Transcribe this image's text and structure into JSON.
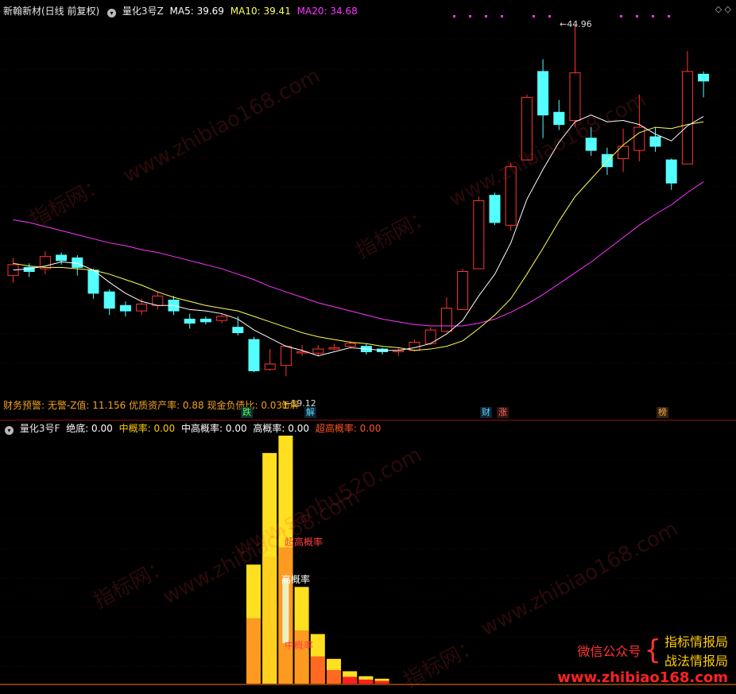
{
  "top": {
    "stock_label": "新翰新材(日线 前复权)",
    "indicator": "量化3号Z",
    "ma5": "MA5: 39.69",
    "ma10": "MA10: 39.41",
    "ma20": "MA20: 34.68",
    "high_label": "44.96",
    "low_label": "19.12",
    "warn_text": "财务预警: 无警-Z值: 11.156 优质资产率: 0.88 现金负债比: 0.031",
    "markers": [
      "跌",
      "解",
      "财",
      "涨",
      "榜"
    ],
    "overlay_text": "缶解"
  },
  "bottom": {
    "indicator": "量化3号F",
    "jue_di": "绝底: 0.00",
    "zhong_gai": "中概率: 0.00",
    "zhong_gao_gai": "中高概率: 0.00",
    "gao_gai": "高概率: 0.00",
    "chao_gao_gai": "超高概率: 0.00",
    "label_chao": "超高概率",
    "label_gao": "高概率",
    "label_zhong": "中概率"
  },
  "brand": {
    "wechat": "微信公众号",
    "line1": "指标情报局",
    "line2": "战法情报局",
    "url": "www.zhibiao168.com"
  },
  "watermarks": [
    "www.zhibiao168.com",
    "指标网：",
    "www.sanhu520.com"
  ],
  "colors": {
    "up": "#ff3333",
    "down": "#54ffff",
    "ma5": "#ffffff",
    "ma10": "#ffff55",
    "ma20": "#ff33ff"
  },
  "chart_data": {
    "type": "candlestick",
    "ma_values": {
      "MA5": 39.69,
      "MA10": 39.41,
      "MA20": 34.68
    },
    "high": 44.96,
    "low": 19.12,
    "candles": [
      {
        "o": 26.5,
        "c": 27.3,
        "h": 27.8,
        "l": 26.0
      },
      {
        "o": 27.1,
        "c": 26.8,
        "h": 27.4,
        "l": 26.4
      },
      {
        "o": 27.0,
        "c": 27.9,
        "h": 28.3,
        "l": 26.6
      },
      {
        "o": 28.0,
        "c": 27.6,
        "h": 28.2,
        "l": 27.3
      },
      {
        "o": 27.8,
        "c": 27.1,
        "h": 28.0,
        "l": 26.5
      },
      {
        "o": 26.9,
        "c": 25.2,
        "h": 27.0,
        "l": 24.8
      },
      {
        "o": 25.3,
        "c": 24.1,
        "h": 25.5,
        "l": 23.6
      },
      {
        "o": 24.3,
        "c": 23.9,
        "h": 24.6,
        "l": 23.5
      },
      {
        "o": 23.9,
        "c": 24.4,
        "h": 24.8,
        "l": 23.6
      },
      {
        "o": 24.3,
        "c": 25.0,
        "h": 25.3,
        "l": 24.0
      },
      {
        "o": 24.7,
        "c": 23.9,
        "h": 25.0,
        "l": 23.6
      },
      {
        "o": 23.3,
        "c": 23.0,
        "h": 23.7,
        "l": 22.6
      },
      {
        "o": 23.3,
        "c": 23.1,
        "h": 23.5,
        "l": 22.9
      },
      {
        "o": 23.2,
        "c": 23.5,
        "h": 23.7,
        "l": 23.0
      },
      {
        "o": 22.7,
        "c": 22.3,
        "h": 23.5,
        "l": 22.1
      },
      {
        "o": 21.8,
        "c": 19.5,
        "h": 22.0,
        "l": 19.4
      },
      {
        "o": 19.6,
        "c": 20.0,
        "h": 21.1,
        "l": 19.5
      },
      {
        "o": 19.9,
        "c": 21.3,
        "h": 21.4,
        "l": 19.1
      },
      {
        "o": 20.9,
        "c": 20.9,
        "h": 21.4,
        "l": 20.6
      },
      {
        "o": 20.8,
        "c": 21.1,
        "h": 21.4,
        "l": 20.6
      },
      {
        "o": 21.1,
        "c": 21.2,
        "h": 21.5,
        "l": 21.0
      },
      {
        "o": 21.3,
        "c": 21.5,
        "h": 21.7,
        "l": 21.2
      },
      {
        "o": 21.3,
        "c": 20.9,
        "h": 21.5,
        "l": 20.7
      },
      {
        "o": 21.1,
        "c": 20.9,
        "h": 21.2,
        "l": 20.7
      },
      {
        "o": 20.9,
        "c": 21.0,
        "h": 21.2,
        "l": 20.6
      },
      {
        "o": 21.0,
        "c": 21.6,
        "h": 21.8,
        "l": 20.9
      },
      {
        "o": 21.5,
        "c": 22.5,
        "h": 22.7,
        "l": 21.4
      },
      {
        "o": 22.4,
        "c": 24.1,
        "h": 24.9,
        "l": 22.3
      },
      {
        "o": 24.0,
        "c": 26.8,
        "h": 27.0,
        "l": 24.0
      },
      {
        "o": 27.0,
        "c": 32.0,
        "h": 32.3,
        "l": 27.0
      },
      {
        "o": 32.4,
        "c": 30.4,
        "h": 32.6,
        "l": 30.2
      },
      {
        "o": 30.2,
        "c": 34.5,
        "h": 34.8,
        "l": 29.8
      },
      {
        "o": 35.0,
        "c": 39.6,
        "h": 39.8,
        "l": 35.0
      },
      {
        "o": 41.5,
        "c": 38.3,
        "h": 42.4,
        "l": 36.6
      },
      {
        "o": 38.5,
        "c": 37.6,
        "h": 39.4,
        "l": 37.2
      },
      {
        "o": 37.9,
        "c": 41.4,
        "h": 44.96,
        "l": 37.4
      },
      {
        "o": 36.6,
        "c": 35.7,
        "h": 37.4,
        "l": 35.3
      },
      {
        "o": 35.4,
        "c": 34.5,
        "h": 35.9,
        "l": 33.9
      },
      {
        "o": 35.1,
        "c": 36.0,
        "h": 37.3,
        "l": 34.1
      },
      {
        "o": 35.7,
        "c": 37.4,
        "h": 39.8,
        "l": 34.9
      },
      {
        "o": 36.7,
        "c": 36.0,
        "h": 37.4,
        "l": 35.6
      },
      {
        "o": 35.0,
        "c": 33.3,
        "h": 35.1,
        "l": 32.8
      },
      {
        "o": 34.7,
        "c": 41.5,
        "h": 43.0,
        "l": 34.7
      },
      {
        "o": 41.3,
        "c": 40.8,
        "h": 41.5,
        "l": 39.6
      }
    ],
    "ma5_line": [
      26.9,
      27.0,
      27.2,
      27.5,
      27.4,
      26.9,
      26.0,
      25.2,
      24.6,
      24.3,
      24.3,
      24.0,
      23.9,
      23.7,
      23.3,
      22.5,
      21.9,
      21.3,
      21.0,
      20.6,
      20.9,
      21.2,
      21.1,
      21.0,
      21.0,
      21.2,
      21.5,
      22.2,
      23.2,
      25.0,
      26.6,
      28.9,
      32.1,
      34.3,
      36.3,
      37.8,
      38.3,
      37.8,
      37.9,
      37.6,
      36.9,
      36.4,
      37.5,
      38.2
    ],
    "ma10_line": [
      27.4,
      27.2,
      27.1,
      27.1,
      27.0,
      26.9,
      26.6,
      26.2,
      25.8,
      25.3,
      24.9,
      24.6,
      24.3,
      24.1,
      23.9,
      23.5,
      23.1,
      22.7,
      22.3,
      22.0,
      21.8,
      21.6,
      21.5,
      21.3,
      21.2,
      21.0,
      21.1,
      21.3,
      21.7,
      22.6,
      23.6,
      24.8,
      26.6,
      28.5,
      30.5,
      32.3,
      33.6,
      34.9,
      36.1,
      37.0,
      37.4,
      37.3,
      37.6,
      37.8
    ],
    "ma20_line": [
      30.6,
      30.4,
      30.1,
      29.8,
      29.5,
      29.2,
      28.9,
      28.7,
      28.4,
      28.2,
      27.9,
      27.6,
      27.3,
      27.0,
      26.6,
      26.2,
      25.7,
      25.3,
      24.9,
      24.5,
      24.2,
      23.9,
      23.6,
      23.3,
      23.1,
      22.9,
      22.8,
      22.8,
      22.8,
      23.0,
      23.3,
      23.8,
      24.4,
      25.1,
      25.9,
      26.7,
      27.5,
      28.4,
      29.3,
      30.2,
      31.0,
      31.7,
      32.6,
      33.4
    ],
    "prob_bars": [
      {
        "i": 15,
        "total": 0.48,
        "layers": [
          0.24,
          0.32,
          0.48
        ]
      },
      {
        "i": 16,
        "total": 0.93,
        "layers": [
          0.22,
          0.4,
          0.6,
          0.93
        ]
      },
      {
        "i": 17,
        "total": 1.0,
        "layers": [
          0.33,
          0.55,
          1.0
        ]
      },
      {
        "i": 18,
        "total": 0.39,
        "layers": [
          0.2,
          0.3,
          0.39
        ]
      },
      {
        "i": 19,
        "total": 0.2,
        "layers": [
          0.1,
          0.2
        ]
      },
      {
        "i": 20,
        "total": 0.1,
        "layers": [
          0.05,
          0.1
        ]
      },
      {
        "i": 21,
        "total": 0.05,
        "layers": [
          0.05
        ]
      },
      {
        "i": 22,
        "total": 0.03,
        "layers": [
          0.03
        ]
      },
      {
        "i": 23,
        "total": 0.02,
        "layers": [
          0.02
        ]
      }
    ]
  }
}
